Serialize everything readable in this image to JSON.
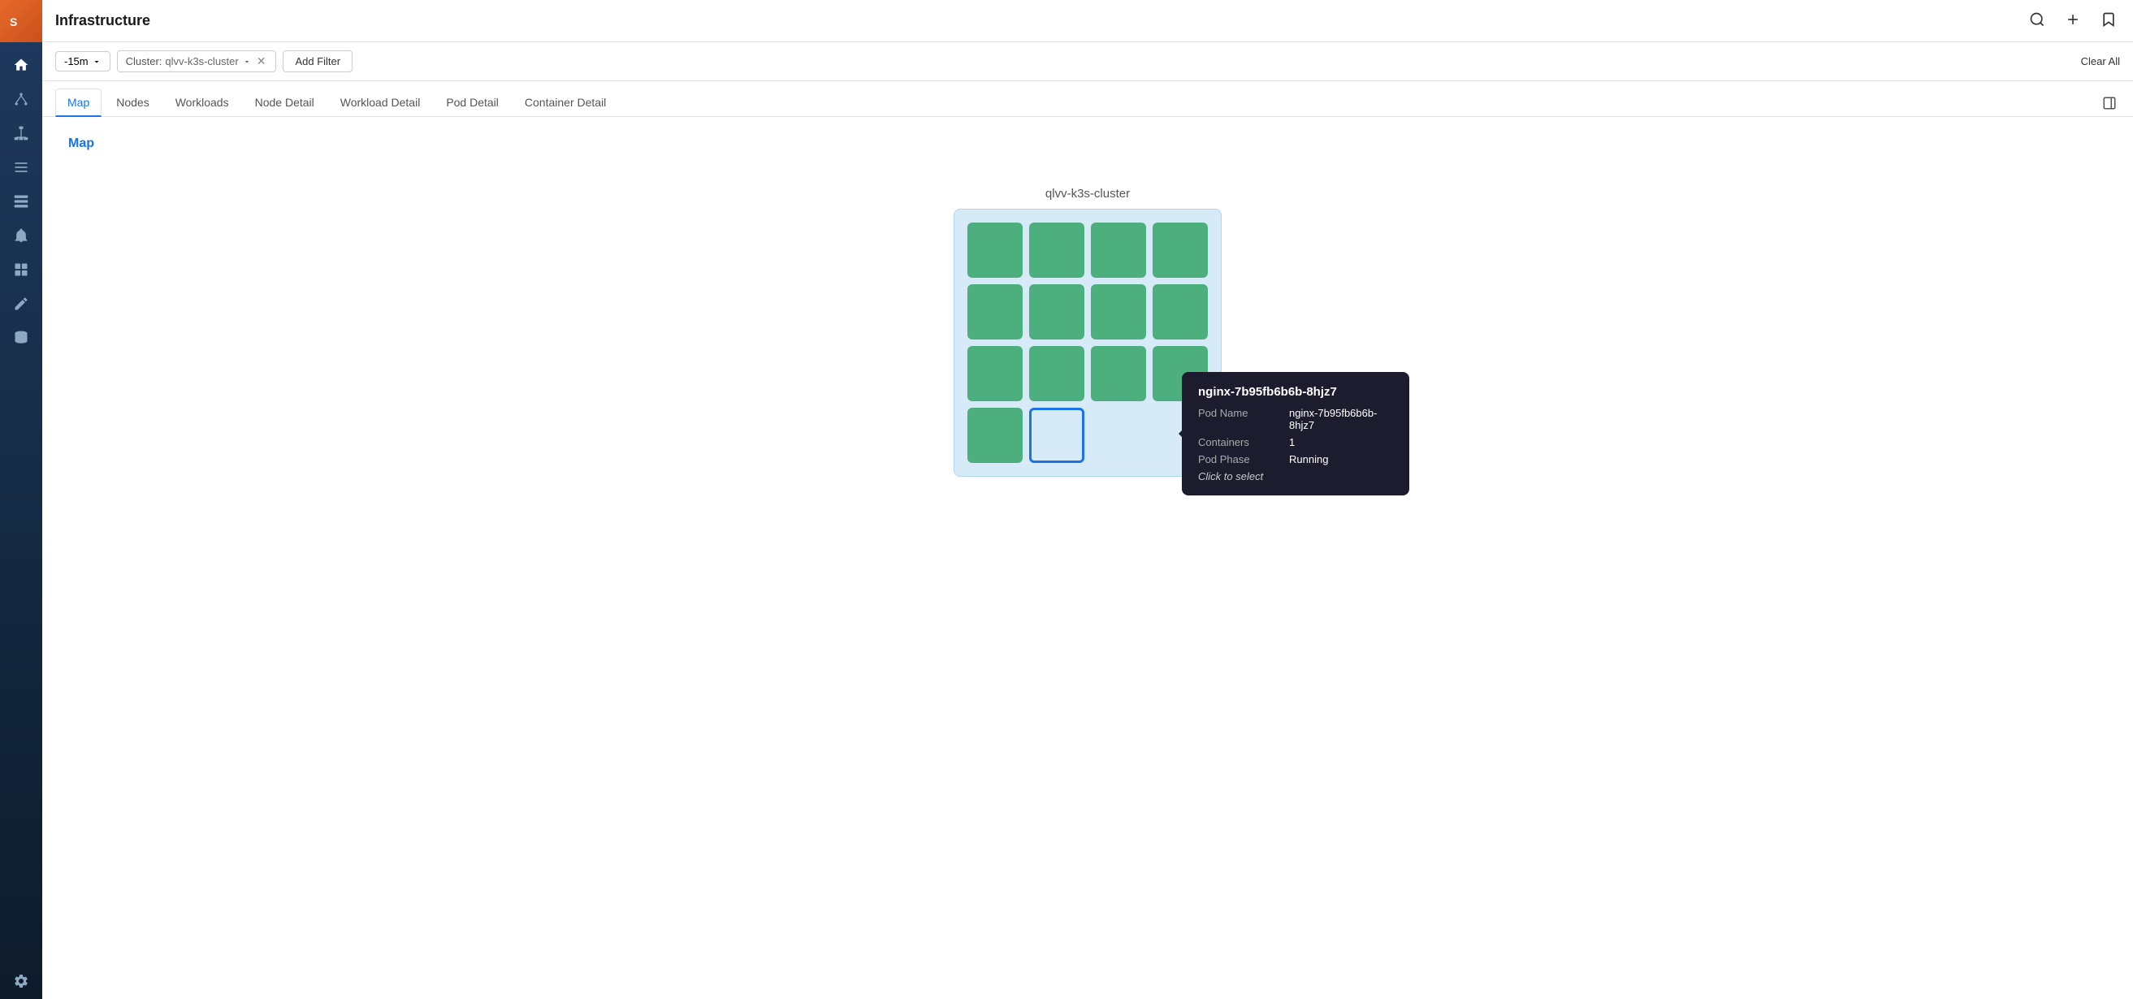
{
  "app": {
    "title": "Infrastructure"
  },
  "sidebar": {
    "items": [
      {
        "name": "home-icon",
        "label": "Home"
      },
      {
        "name": "topology-icon",
        "label": "Topology"
      },
      {
        "name": "hierarchy-icon",
        "label": "Hierarchy"
      },
      {
        "name": "list-icon",
        "label": "List"
      },
      {
        "name": "storage-icon",
        "label": "Storage"
      },
      {
        "name": "bell-icon",
        "label": "Alerts"
      },
      {
        "name": "dashboard-icon",
        "label": "Dashboard"
      },
      {
        "name": "pencil-icon",
        "label": "Edit"
      },
      {
        "name": "database-icon",
        "label": "Database"
      },
      {
        "name": "settings-icon",
        "label": "Settings"
      }
    ]
  },
  "filterbar": {
    "time_label": "-15m",
    "cluster_label": "Cluster:",
    "cluster_value": "qlvv-k3s-cluster",
    "add_filter": "Add Filter",
    "clear_all": "Clear All"
  },
  "tabs": [
    {
      "id": "map",
      "label": "Map",
      "active": true
    },
    {
      "id": "nodes",
      "label": "Nodes",
      "active": false
    },
    {
      "id": "workloads",
      "label": "Workloads",
      "active": false
    },
    {
      "id": "node-detail",
      "label": "Node Detail",
      "active": false
    },
    {
      "id": "workload-detail",
      "label": "Workload Detail",
      "active": false
    },
    {
      "id": "pod-detail",
      "label": "Pod Detail",
      "active": false
    },
    {
      "id": "container-detail",
      "label": "Container Detail",
      "active": false
    }
  ],
  "content": {
    "title": "Map"
  },
  "cluster": {
    "name": "qlvv-k3s-cluster"
  },
  "tooltip": {
    "pod_name_label": "nginx-7b95fb6b6b-8hjz7",
    "fields": [
      {
        "key": "Pod Name",
        "value": "nginx-7b95fb6b6b-8hjz7"
      },
      {
        "key": "Containers",
        "value": "1"
      },
      {
        "key": "Pod Phase",
        "value": "Running"
      }
    ],
    "action": "Click to select"
  }
}
